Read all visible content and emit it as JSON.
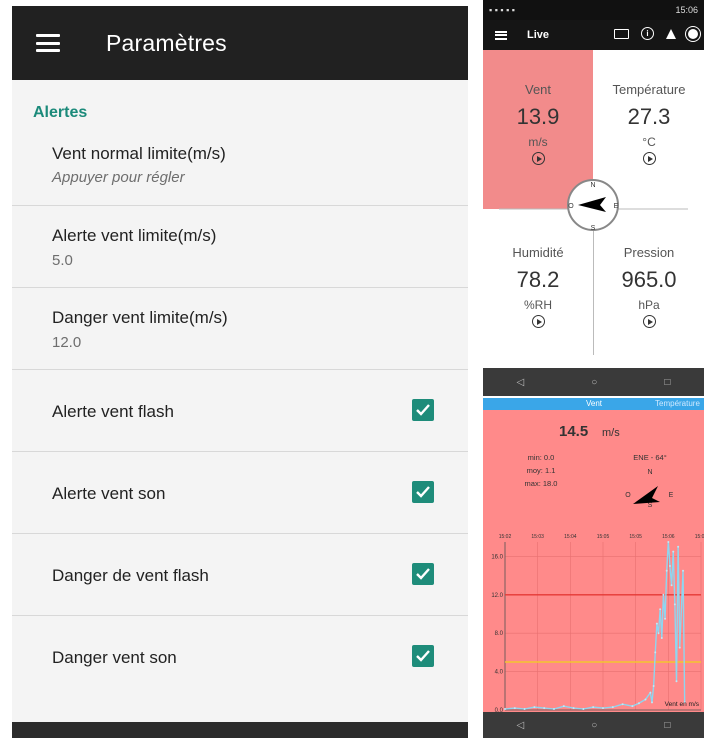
{
  "settings": {
    "title": "Paramètres",
    "section": "Alertes",
    "prefs": [
      {
        "title": "Vent normal limite(m/s)",
        "summary": "Appuyer pour régler"
      },
      {
        "title": "Alerte vent limite(m/s)",
        "summary": "5.0"
      },
      {
        "title": "Danger vent limite(m/s)",
        "summary": "12.0"
      },
      {
        "title": "Alerte vent flash",
        "checked": true
      },
      {
        "title": "Alerte vent son",
        "checked": true
      },
      {
        "title": "Danger de vent flash",
        "checked": true
      },
      {
        "title": "Danger vent son",
        "checked": true
      }
    ],
    "colors": {
      "accent": "#1b8a7a",
      "appbar": "#212121"
    }
  },
  "live": {
    "status_time": "15:06",
    "toolbar_title": "Live",
    "icons": [
      "menu-icon",
      "battery-icon",
      "info-icon",
      "bell-icon",
      "record-icon"
    ],
    "cells": [
      {
        "label": "Vent",
        "value": "13.9",
        "unit": "m/s"
      },
      {
        "label": "Température",
        "value": "27.3",
        "unit": "°C"
      },
      {
        "label": "Humidité",
        "value": "78.2",
        "unit": "%RH"
      },
      {
        "label": "Pression",
        "value": "965.0",
        "unit": "hPa"
      }
    ],
    "compass": {
      "n": "N",
      "s": "S",
      "e": "E",
      "o": "O"
    },
    "nav": {
      "back": "◁",
      "home": "○",
      "recent": "□"
    },
    "colors": {
      "wind_cell": "#f28b8b"
    }
  },
  "detail": {
    "tabs": [
      "Vent",
      "Température"
    ],
    "current_value": "14.5",
    "current_unit": "m/s",
    "stats": {
      "min": "min: 0.0",
      "moy": "moy: 1.1",
      "max": "max: 18.0"
    },
    "direction": "ENE - 64°",
    "compass": {
      "n": "N",
      "s": "S",
      "e": "E",
      "o": "O"
    },
    "nav": {
      "back": "◁",
      "home": "○",
      "recent": "□"
    }
  },
  "chart_data": {
    "type": "line",
    "title": "",
    "xlabel": "",
    "ylabel": "",
    "legend": "Vent en m/s",
    "x_ticks": [
      "15:02",
      "15:03",
      "15:04",
      "15:05",
      "15:05",
      "15:06",
      "15:07"
    ],
    "y_ticks": [
      "0.0",
      "4.0",
      "8.0",
      "12.0",
      "16.0"
    ],
    "ylim": [
      0,
      17.5
    ],
    "thresholds": [
      {
        "value": 12.0,
        "color": "#e53935"
      },
      {
        "value": 5.0,
        "color": "#f4c430"
      }
    ],
    "series": [
      {
        "name": "Vent en m/s",
        "x": [
          0.0,
          0.3,
          0.6,
          0.9,
          1.2,
          1.5,
          1.8,
          2.1,
          2.4,
          2.7,
          3.0,
          3.3,
          3.6,
          3.9,
          4.1,
          4.3,
          4.45,
          4.5,
          4.55,
          4.6,
          4.65,
          4.7,
          4.75,
          4.8,
          4.85,
          4.9,
          4.95,
          5.0,
          5.05,
          5.1,
          5.15,
          5.2,
          5.25,
          5.3,
          5.35,
          5.45,
          5.5
        ],
        "y": [
          0.1,
          0.2,
          0.1,
          0.3,
          0.2,
          0.1,
          0.4,
          0.2,
          0.1,
          0.3,
          0.2,
          0.3,
          0.6,
          0.4,
          0.7,
          1.1,
          1.8,
          0.8,
          2.5,
          6.0,
          9.0,
          8.0,
          10.5,
          7.5,
          12.0,
          9.5,
          14.5,
          17.5,
          15.0,
          13.0,
          16.5,
          11.0,
          3.0,
          17.0,
          6.5,
          14.5,
          0.8
        ]
      }
    ]
  }
}
